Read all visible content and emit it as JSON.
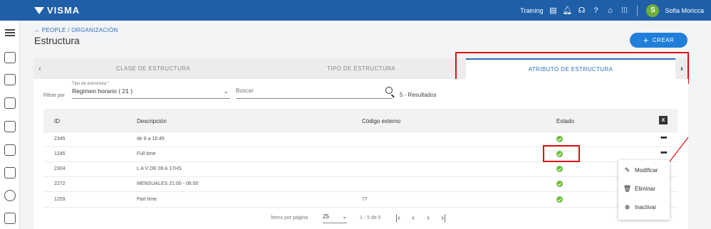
{
  "topbar": {
    "brand": "VISMA",
    "training_label": "Training",
    "user_initial": "S",
    "user_name": "Sofia Moricca",
    "icons": [
      "database-icon",
      "bell-icon",
      "headset-icon",
      "help-icon",
      "home-icon",
      "apps-grid-icon"
    ]
  },
  "sidebar": {
    "icons": [
      "menu-icon",
      "people-icon",
      "organization-icon",
      "clipboard-icon",
      "calendar-icon",
      "documents-icon",
      "report-icon",
      "settings-icon",
      "folders-icon"
    ]
  },
  "breadcrumb": {
    "back_arrow": "←",
    "part1": "PEOPLE",
    "separator": " / ",
    "part2": "ORGANIZACIÓN"
  },
  "page_title": "Estructura",
  "actions": {
    "create_label": "CREAR",
    "create_icon": "+"
  },
  "tabs": {
    "prev_arrow": "‹",
    "next_arrow": "›",
    "items": [
      {
        "label": "CLASE DE ESTRUCTURA",
        "active": false
      },
      {
        "label": "TIPO DE ESTRUCTURA",
        "active": false
      },
      {
        "label": "ATRIBUTO DE ESTRUCTURA",
        "active": true
      }
    ]
  },
  "filters": {
    "filter_label": "Filtrar por",
    "type_label": "Tipo de estructura *",
    "type_value": "Regimen horario ( 21 )",
    "search_placeholder": "Buscar",
    "results_text": "5 - Resultados"
  },
  "table": {
    "columns": [
      "ID",
      "Descripción",
      "Código externo",
      "Estado"
    ],
    "export_icon_label": "X",
    "rows": [
      {
        "id": "2345",
        "descripcion": "de 8 a 16:45",
        "codigo": "",
        "estado": "active"
      },
      {
        "id": "1245",
        "descripcion": "Full time",
        "codigo": "",
        "estado": "active"
      },
      {
        "id": "2304",
        "descripcion": "L A V DE 09 A 17HS",
        "codigo": "",
        "estado": "active"
      },
      {
        "id": "2272",
        "descripcion": "MENSUALES 21:00 - 06:00",
        "codigo": "",
        "estado": "active"
      },
      {
        "id": "1259",
        "descripcion": "Part time",
        "codigo": "77",
        "estado": "active"
      }
    ],
    "row_menu_label": "•••"
  },
  "pagination": {
    "items_per_page_label": "Ítems por página",
    "per_page_value": "25",
    "range_text": "1 - 5 de 5",
    "first": "|‹",
    "prev": "‹",
    "next": "›",
    "last": "›|"
  },
  "context_menu": {
    "items": [
      {
        "label": "Modificar",
        "icon": "pencil-icon"
      },
      {
        "label": "Eliminar",
        "icon": "trash-icon"
      },
      {
        "label": "Inactivar",
        "icon": "block-icon"
      }
    ]
  },
  "colors": {
    "topbar": "#1f5fa8",
    "accent": "#1f7fd9",
    "highlight": "#e01010",
    "status_active": "#6cbe3a"
  }
}
